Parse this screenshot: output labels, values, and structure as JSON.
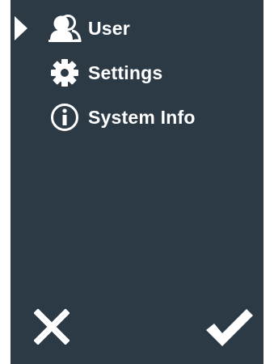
{
  "menu": {
    "items": [
      {
        "label": "User",
        "icon": "user-icon",
        "selected": true
      },
      {
        "label": "Settings",
        "icon": "gear-icon",
        "selected": false
      },
      {
        "label": "System Info",
        "icon": "info-icon",
        "selected": false
      }
    ]
  },
  "actions": {
    "cancel_icon": "close-icon",
    "confirm_icon": "checkmark-icon"
  },
  "colors": {
    "background": "#2c3a45",
    "foreground": "#ffffff",
    "page": "#ffffff"
  }
}
